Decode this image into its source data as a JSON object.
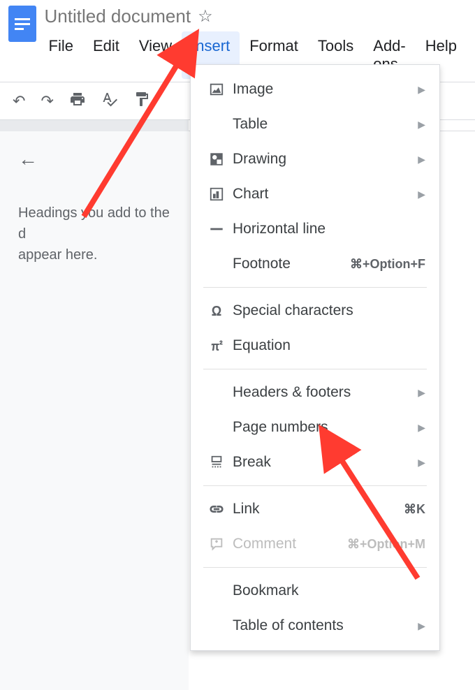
{
  "header": {
    "title": "Untitled document"
  },
  "menubar": {
    "items": [
      "File",
      "Edit",
      "View",
      "Insert",
      "Format",
      "Tools",
      "Add-ons",
      "Help"
    ],
    "active": "Insert"
  },
  "outline": {
    "text1": "Headings you add to the d",
    "text2": "appear here."
  },
  "dropdown": {
    "items": [
      {
        "label": "Image",
        "icon": "image",
        "submenu": true
      },
      {
        "label": "Table",
        "icon": "",
        "submenu": true
      },
      {
        "label": "Drawing",
        "icon": "drawing",
        "submenu": true
      },
      {
        "label": "Chart",
        "icon": "chart",
        "submenu": true
      },
      {
        "label": "Horizontal line",
        "icon": "hline",
        "submenu": false
      },
      {
        "label": "Footnote",
        "icon": "",
        "submenu": false,
        "shortcut": "⌘+Option+F"
      },
      {
        "sep": true
      },
      {
        "label": "Special characters",
        "icon": "omega",
        "submenu": false
      },
      {
        "label": "Equation",
        "icon": "pi",
        "submenu": false
      },
      {
        "sep": true
      },
      {
        "label": "Headers & footers",
        "icon": "",
        "submenu": true
      },
      {
        "label": "Page numbers",
        "icon": "",
        "submenu": true
      },
      {
        "label": "Break",
        "icon": "break",
        "submenu": true
      },
      {
        "sep": true
      },
      {
        "label": "Link",
        "icon": "link",
        "submenu": false,
        "shortcut": "⌘K"
      },
      {
        "label": "Comment",
        "icon": "comment",
        "submenu": false,
        "shortcut": "⌘+Option+M",
        "disabled": true
      },
      {
        "sep": true
      },
      {
        "label": "Bookmark",
        "icon": "",
        "submenu": false
      },
      {
        "label": "Table of contents",
        "icon": "",
        "submenu": true
      }
    ]
  }
}
